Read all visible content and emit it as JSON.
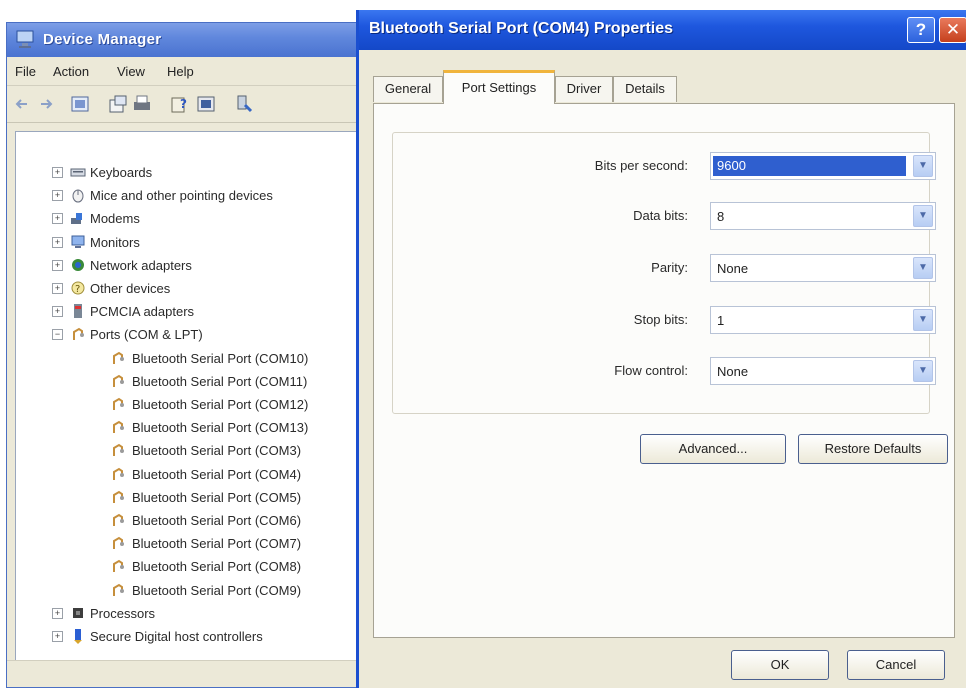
{
  "device_manager": {
    "title": "Device Manager",
    "menu": [
      "File",
      "Action",
      "View",
      "Help"
    ],
    "toolbar_icons": [
      "back-arrow-icon",
      "forward-arrow-icon",
      "view-icon",
      "properties-icon",
      "print-icon",
      "help-icon",
      "console-icon",
      "scan-hardware-icon"
    ],
    "tree": [
      {
        "label": "Keyboards",
        "icon": "keyboard-icon",
        "level": 0,
        "expander": "+"
      },
      {
        "label": "Mice and other pointing devices",
        "icon": "mouse-icon",
        "level": 0,
        "expander": "+"
      },
      {
        "label": "Modems",
        "icon": "modem-icon",
        "level": 0,
        "expander": "+"
      },
      {
        "label": "Monitors",
        "icon": "monitor-icon",
        "level": 0,
        "expander": "+"
      },
      {
        "label": "Network adapters",
        "icon": "network-icon",
        "level": 0,
        "expander": "+"
      },
      {
        "label": "Other devices",
        "icon": "other-devices-icon",
        "level": 0,
        "expander": "+"
      },
      {
        "label": "PCMCIA adapters",
        "icon": "pcmcia-icon",
        "level": 0,
        "expander": "+"
      },
      {
        "label": "Ports (COM & LPT)",
        "icon": "port-icon",
        "level": 0,
        "expander": "−"
      },
      {
        "label": "Bluetooth Serial Port (COM10)",
        "icon": "port-icon",
        "level": 1,
        "expander": ""
      },
      {
        "label": "Bluetooth Serial Port (COM11)",
        "icon": "port-icon",
        "level": 1,
        "expander": ""
      },
      {
        "label": "Bluetooth Serial Port (COM12)",
        "icon": "port-icon",
        "level": 1,
        "expander": ""
      },
      {
        "label": "Bluetooth Serial Port (COM13)",
        "icon": "port-icon",
        "level": 1,
        "expander": ""
      },
      {
        "label": "Bluetooth Serial Port (COM3)",
        "icon": "port-icon",
        "level": 1,
        "expander": ""
      },
      {
        "label": "Bluetooth Serial Port (COM4)",
        "icon": "port-icon",
        "level": 1,
        "expander": ""
      },
      {
        "label": "Bluetooth Serial Port (COM5)",
        "icon": "port-icon",
        "level": 1,
        "expander": ""
      },
      {
        "label": "Bluetooth Serial Port (COM6)",
        "icon": "port-icon",
        "level": 1,
        "expander": ""
      },
      {
        "label": "Bluetooth Serial Port (COM7)",
        "icon": "port-icon",
        "level": 1,
        "expander": ""
      },
      {
        "label": "Bluetooth Serial Port (COM8)",
        "icon": "port-icon",
        "level": 1,
        "expander": ""
      },
      {
        "label": "Bluetooth Serial Port (COM9)",
        "icon": "port-icon",
        "level": 1,
        "expander": ""
      },
      {
        "label": "Processors",
        "icon": "processor-icon",
        "level": 0,
        "expander": "+"
      },
      {
        "label": "Secure Digital host controllers",
        "icon": "sd-controller-icon",
        "level": 0,
        "expander": "+"
      }
    ]
  },
  "dialog": {
    "title": "Bluetooth Serial Port (COM4) Properties",
    "help_glyph": "?",
    "close_glyph": "✕",
    "tabs": [
      "General",
      "Port Settings",
      "Driver",
      "Details"
    ],
    "active_tab": "Port Settings",
    "fields": [
      {
        "label": "Bits per second:",
        "value": "9600",
        "selected": true
      },
      {
        "label": "Data bits:",
        "value": "8",
        "selected": false
      },
      {
        "label": "Parity:",
        "value": "None",
        "selected": false
      },
      {
        "label": "Stop bits:",
        "value": "1",
        "selected": false
      },
      {
        "label": "Flow control:",
        "value": "None",
        "selected": false
      }
    ],
    "advanced_label": "Advanced...",
    "restore_label": "Restore Defaults",
    "ok_label": "OK",
    "cancel_label": "Cancel"
  },
  "colors": {
    "dialog_title_bar": "#1e57de",
    "dm_title_bar": "#5f86dc",
    "window_face": "#ece9d8",
    "selection": "#2f5fcf",
    "active_tab_highlight": "#f0b43c"
  }
}
